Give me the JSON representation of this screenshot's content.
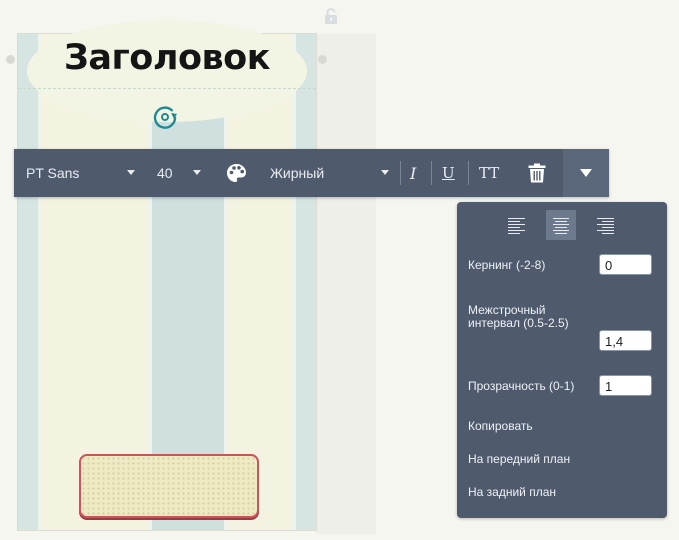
{
  "canvas": {
    "title": "Заголовок"
  },
  "toolbar": {
    "font_family": "PT Sans",
    "font_size": "40",
    "font_weight": "Жирный",
    "italic_label": "I",
    "underline_label": "U",
    "caps_label": "TT",
    "icons": [
      "palette-icon",
      "trash-icon",
      "chevron-down-icon"
    ]
  },
  "panel": {
    "alignment": {
      "options": [
        "left",
        "center",
        "right"
      ],
      "selected": "center"
    },
    "kerning_label": "Кернинг (-2-8)",
    "kerning_value": "0",
    "line_spacing_label_1": "Межстрочный",
    "line_spacing_label_2": "интервал (0.5-2.5)",
    "line_spacing_value": "1,4",
    "opacity_label": "Прозрачность (0-1)",
    "opacity_value": "1",
    "copy_label": "Копировать",
    "bring_front_label": "На передний план",
    "send_back_label": "На задний план"
  },
  "colors": {
    "toolbar_bg": "#4f5b6d",
    "accent_teal": "#1f8a93",
    "badge_border": "#c9545a"
  }
}
